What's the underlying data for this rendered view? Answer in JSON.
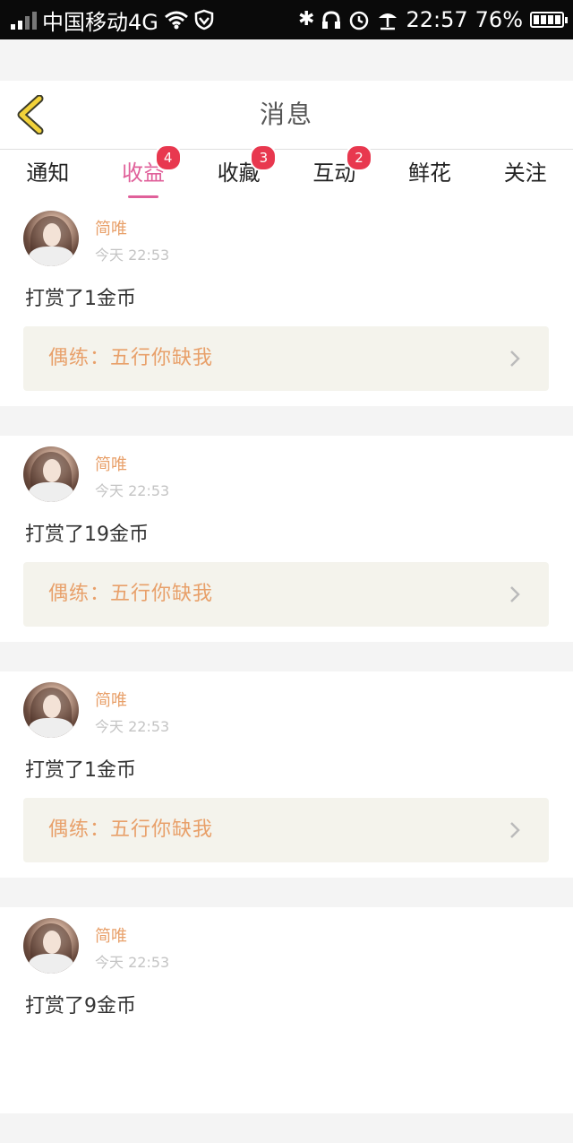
{
  "status_bar": {
    "carrier": "中国移动4G",
    "time": "22:57",
    "battery": "76%",
    "icons": [
      "signal-icon",
      "wifi-icon",
      "shield-icon",
      "bluetooth-icon",
      "headphones-icon",
      "alarm-icon",
      "umbrella-icon",
      "battery-icon"
    ]
  },
  "header": {
    "title": "消息",
    "back_icon": "chevron-left-icon"
  },
  "tabs": [
    {
      "label": "通知",
      "badge": ""
    },
    {
      "label": "收益",
      "badge": "4",
      "active": true
    },
    {
      "label": "收藏",
      "badge": "3"
    },
    {
      "label": "互动",
      "badge": "2"
    },
    {
      "label": "鲜花",
      "badge": ""
    },
    {
      "label": "关注",
      "badge": ""
    }
  ],
  "colors": {
    "accent": "#e0609a",
    "badge": "#e8384f",
    "name": "#e8a06a",
    "link_bg": "#f4f3ec"
  },
  "messages": [
    {
      "name": "简唯",
      "time": "今天 22:53",
      "text": "打赏了1金币",
      "link": "偶练：五行你缺我"
    },
    {
      "name": "简唯",
      "time": "今天 22:53",
      "text": "打赏了19金币",
      "link": "偶练：五行你缺我"
    },
    {
      "name": "简唯",
      "time": "今天 22:53",
      "text": "打赏了1金币",
      "link": "偶练：五行你缺我"
    },
    {
      "name": "简唯",
      "time": "今天 22:53",
      "text": "打赏了9金币",
      "link": ""
    }
  ]
}
